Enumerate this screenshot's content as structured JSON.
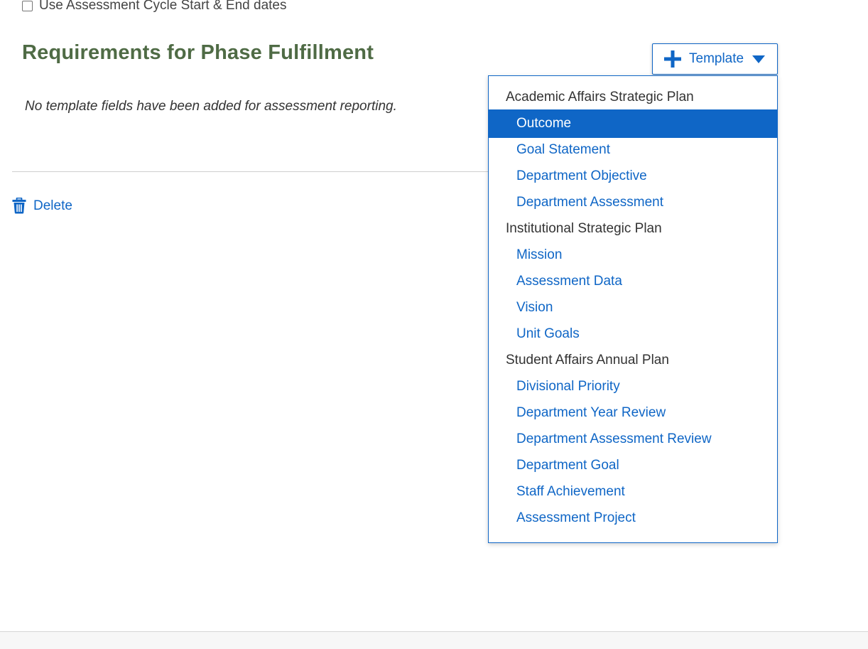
{
  "options": {
    "use_cycle_dates_label": "Use Assessment Cycle Start & End dates",
    "use_cycle_dates_checked": false
  },
  "section": {
    "title": "Requirements for Phase Fulfillment",
    "empty_message": "No template fields have been added for assessment reporting."
  },
  "actions": {
    "delete_label": "Delete"
  },
  "template_button": {
    "label": "Template"
  },
  "template_menu": {
    "groups": [
      {
        "label": "Academic Affairs Strategic Plan",
        "items": [
          "Outcome",
          "Goal Statement",
          "Department Objective",
          "Department Assessment"
        ]
      },
      {
        "label": "Institutional Strategic Plan",
        "items": [
          "Mission",
          "Assessment Data",
          "Vision",
          "Unit Goals"
        ]
      },
      {
        "label": "Student Affairs Annual Plan",
        "items": [
          "Divisional Priority",
          "Department Year Review",
          "Department Assessment Review",
          "Department Goal",
          "Staff Achievement",
          "Assessment Project"
        ]
      }
    ],
    "active_item": "Outcome"
  },
  "colors": {
    "accent": "#0f66c6",
    "heading": "#4f6b45"
  }
}
